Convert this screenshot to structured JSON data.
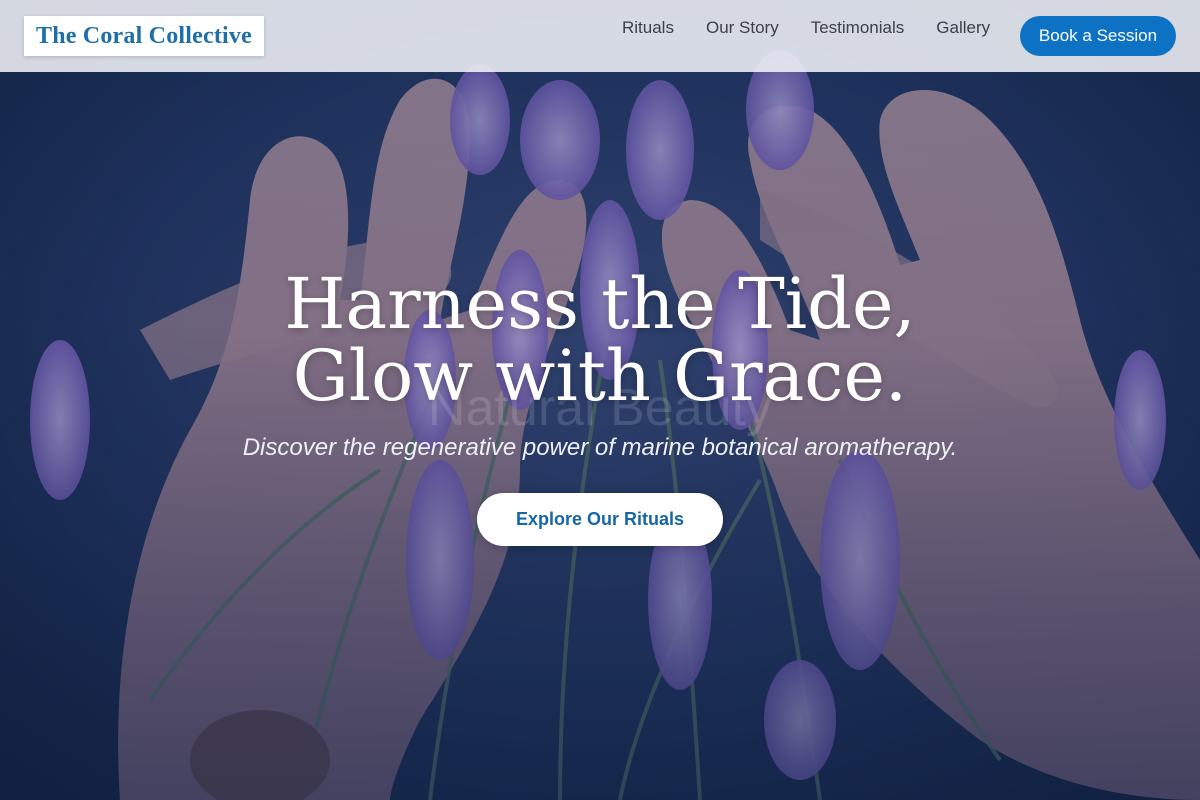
{
  "header": {
    "logo": "The Coral Collective",
    "nav": [
      "Rituals",
      "Our Story",
      "Testimonials",
      "Gallery"
    ],
    "cta_label": "Book a Session"
  },
  "hero": {
    "headline_line1": "Harness the Tide,",
    "headline_line2": "Glow with Grace.",
    "ghost_text": "Natural Beauty",
    "tagline": "Discover the regenerative power of marine botanical aromatherapy.",
    "button_label": "Explore Our Rituals",
    "background_image": "hands-cradling-lavender-photo"
  },
  "colors": {
    "brand": "#1e6fa8",
    "cta": "#0d72c4",
    "hero_overlay": "#1c2b4d"
  }
}
